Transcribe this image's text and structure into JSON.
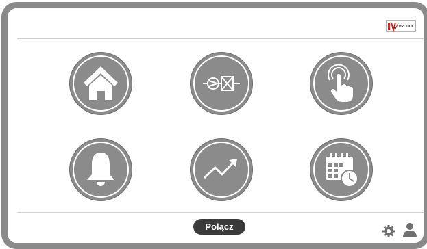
{
  "header": {
    "logo_text": "PRODUKT"
  },
  "tiles": [
    {
      "icon": "home-icon"
    },
    {
      "icon": "ventilation-icon"
    },
    {
      "icon": "touch-hand-icon"
    },
    {
      "icon": "bell-icon"
    },
    {
      "icon": "trend-chart-icon"
    },
    {
      "icon": "calendar-clock-icon"
    }
  ],
  "footer": {
    "connect_label": "Połącz",
    "settings_icon": "gear-icon",
    "user_icon": "user-icon"
  },
  "colors": {
    "frame": "#8a8a8a",
    "tile": "#8b8b8b",
    "button": "#3a3a3a",
    "logo_red": "#c0281c"
  }
}
